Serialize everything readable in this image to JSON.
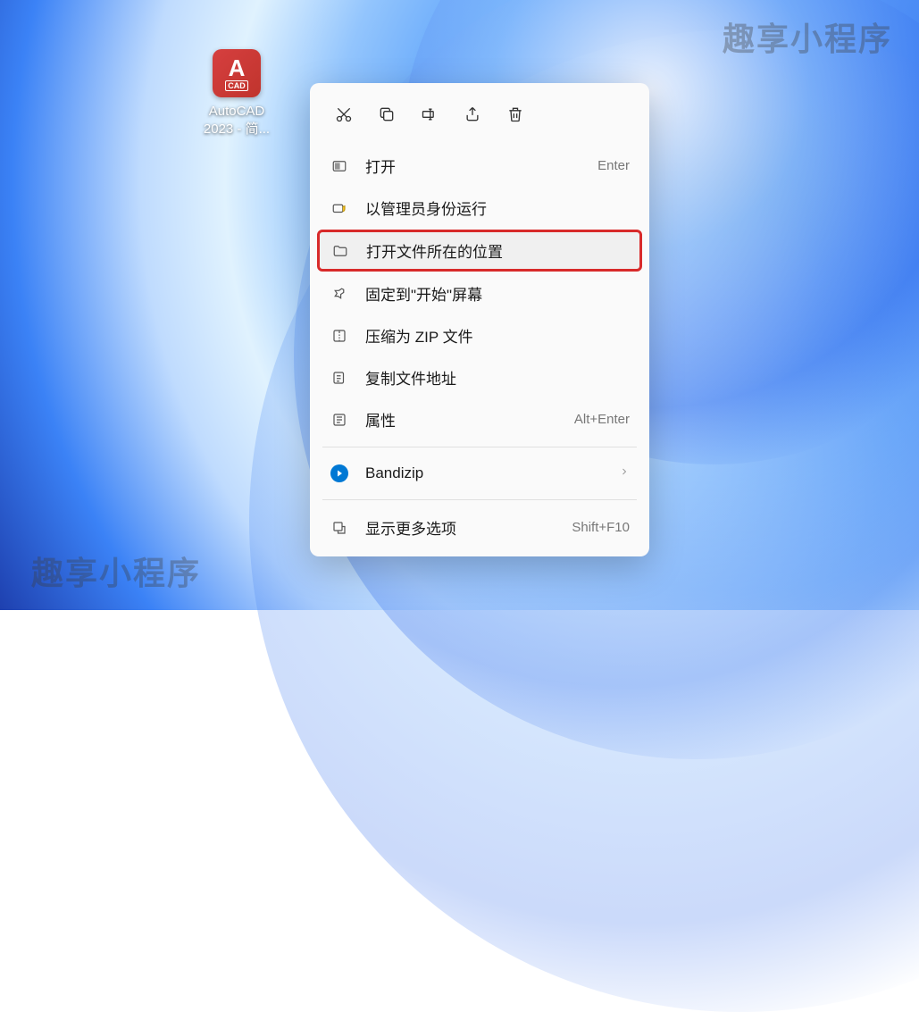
{
  "watermark_text": "趣享小程序",
  "desktop_icon": {
    "app_letter": "A",
    "app_sub": "CAD",
    "label_line1": "AutoCAD",
    "label_line2": "2023 - 简..."
  },
  "action_bar": {
    "cut": "cut-icon",
    "copy": "copy-icon",
    "rename": "rename-icon",
    "share": "share-icon",
    "delete": "delete-icon"
  },
  "menu": {
    "open": {
      "label": "打开",
      "shortcut": "Enter"
    },
    "run_admin": {
      "label": "以管理员身份运行"
    },
    "open_location": {
      "label": "打开文件所在的位置"
    },
    "pin_start": {
      "label": "固定到\"开始\"屏幕"
    },
    "compress_zip": {
      "label": "压缩为 ZIP 文件"
    },
    "copy_path": {
      "label": "复制文件地址"
    },
    "properties": {
      "label": "属性",
      "shortcut": "Alt+Enter"
    },
    "bandizip": {
      "label": "Bandizip"
    },
    "show_more": {
      "label": "显示更多选项",
      "shortcut": "Shift+F10"
    }
  }
}
